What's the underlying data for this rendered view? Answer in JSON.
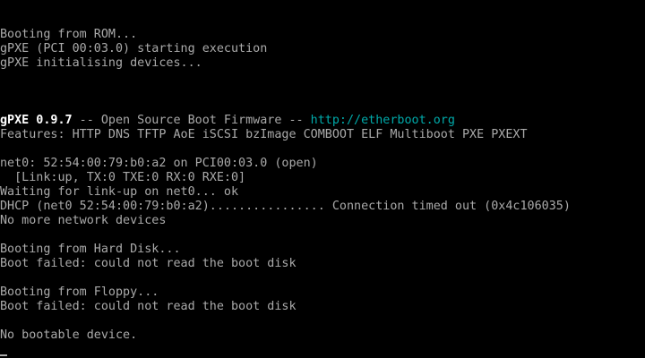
{
  "console": {
    "rom_boot": "Booting from ROM...",
    "gpxe_start": "gPXE (PCI 00:03.0) starting execution",
    "gpxe_init": "gPXE initialising devices...",
    "banner_name": "gPXE 0.9.7",
    "banner_sep1": " -- Open Source Boot Firmware -- ",
    "banner_url": "http://etherboot.org",
    "features": "Features: HTTP DNS TFTP AoE iSCSI bzImage COMBOOT ELF Multiboot PXE PXEXT",
    "net0_info": "net0: 52:54:00:79:b0:a2 on PCI00:03.0 (open)",
    "link_status": "  [Link:up, TX:0 TXE:0 RX:0 RXE:0]",
    "waiting_link": "Waiting for link-up on net0... ok",
    "dhcp_status": "DHCP (net0 52:54:00:79:b0:a2)................ Connection timed out (0x4c106035)",
    "no_network": "No more network devices",
    "hd_boot": "Booting from Hard Disk...",
    "hd_fail": "Boot failed: could not read the boot disk",
    "floppy_boot": "Booting from Floppy...",
    "floppy_fail": "Boot failed: could not read the boot disk",
    "no_bootable": "No bootable device."
  },
  "colors": {
    "background": "#000000",
    "text": "#aaaaaa",
    "bold": "#ffffff",
    "url": "#00aaaa"
  }
}
